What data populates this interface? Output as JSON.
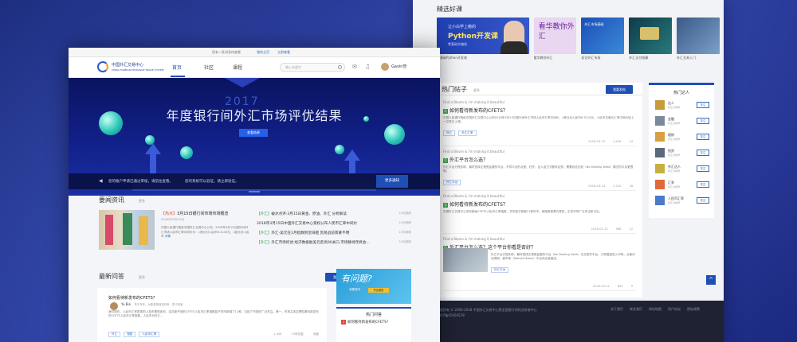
{
  "back": {
    "courses_title": "精选好课",
    "courses": [
      {
        "line1": "让小白学上瘾的",
        "line2": "Python开发课",
        "line3": "零基础学编程",
        "caption": "零基础Python开发课"
      },
      {
        "title": "看华教你外汇",
        "caption": "看华教你外汇"
      },
      {
        "title": "外汇市场基础",
        "caption": "初识外汇市场"
      },
      {
        "title": "",
        "caption": "外汇支付结算"
      },
      {
        "title": "",
        "caption": "外汇交易入门"
      }
    ],
    "hot_posts": {
      "title": "热门帖子",
      "more": "更多",
      "button": "我要发帖",
      "posts": [
        {
          "meta": "Find a Bloom & I'm making it beautiful",
          "title": "如何看待新发布的CFETS？",
          "body": "中国人民银行授权中国外汇交易中心公布2018年3月15日银行间外汇市场人民币汇率中间价，1美元对人民币6.3215元，人民币兑美元汇率中间价较上一交易日上调。",
          "tags": [
            "外汇",
            "外汇汇率"
          ],
          "date": "2018-03-15",
          "views": "1,456",
          "likes": "24"
        },
        {
          "meta": "Find a Bloom & I'm making it beautiful",
          "title": "外汇平台怎么选？",
          "body": "外汇平台分很多种，最好选择正规受监管的平台。不同平台的点差、杠杆、出入金方式都有区别，需要综合比较（No Dealing Desk）模式的平台更透明。",
          "tags": [
            "外汇平台"
          ],
          "date": "2018-03-14",
          "views": "1,210",
          "likes": "18"
        },
        {
          "meta": "Find a Bloom & I'm making it beautiful",
          "title": "如何看待新发布的CFETS？",
          "body": "中国外汇交易中心发布新版CFETS人民币汇率指数，货币篮子新增11种货币，使指数更具代表性，引发市场广泛关注和讨论。",
          "tags": [
            "外汇",
            "外汇汇率"
          ],
          "date": "2018-03-13",
          "views": "986",
          "likes": "12"
        },
        {
          "meta": "Find a Bloom & I'm making it beautiful",
          "title": "外汇平台怎么选？这个平台你看是否好？",
          "body": "外汇平台分很多种，最好选择正规受监管的平台（No Dealing Desk）无交易员平台，订单直接进入市场，点差浮动透明，做市商（Market Maker）平台则点差固定。",
          "tags": [
            "外汇平台"
          ],
          "date": "2018-03-12",
          "views": "854",
          "likes": "9"
        }
      ]
    },
    "tutors": {
      "title": "热门达人",
      "follow": "关注",
      "items": [
        {
          "name": "达人",
          "sub": "外汇分析师"
        },
        {
          "name": "金融",
          "sub": "外汇分析师"
        },
        {
          "name": "理财",
          "sub": "外汇分析师"
        },
        {
          "name": "投资",
          "sub": "外汇分析师"
        },
        {
          "name": "外汇达人",
          "sub": "外汇分析师"
        },
        {
          "name": "汇率",
          "sub": "外汇分析师"
        },
        {
          "name": "人民币汇率",
          "sub": "外汇分析师"
        }
      ]
    },
    "footer": {
      "copy": "版权所有 © 2000-2018 中国外汇交易中心暨全国银行间同业拆借中心",
      "icp": "沪ICP备05004578",
      "links": [
        "关于我们",
        "联系我们",
        "网站地图",
        "用户协议",
        "隐私政策"
      ]
    },
    "top_btn": "^"
  },
  "front": {
    "notice": {
      "text": "您有一条消息待查看",
      "link1": "我的主页",
      "link2": "立即查看"
    },
    "logo": {
      "cn": "中国外汇交易中心",
      "en": "CHINA FOREIGN EXCHANGE TRADE SYSTEM"
    },
    "nav": {
      "home": "首页",
      "community": "社区",
      "course": "课程"
    },
    "search_placeholder": "输入关键字",
    "user": "Gavin告",
    "banner": {
      "year": "2017",
      "title": "年度银行间外汇市场评优结果",
      "cta": "查看结果",
      "ticker1": "您的账户申请已通过审核，请前往查看。",
      "ticker2": "您的系统可以验证，请立即验证。",
      "more": "更多通知"
    },
    "news": {
      "title": "要闻资讯",
      "more": "更多",
      "main_tag": "【热点】",
      "main_title": "3月15日银行间市场市场概览",
      "main_date": "2018年03月15日",
      "main_desc": "中国人民银行授权中国外汇交易中心公布，2018年3月15日银行间外汇市场人民币汇率中间价为：1美元对人民币6.3145元，1欧元对人民币",
      "main_link": "详情",
      "list": [
        {
          "tag": "【外汇】",
          "title": "破冰点评:3月15日黄金、原油、外汇 分析解读",
          "date": "15分钟前"
        },
        {
          "tag": "",
          "title": "2018年3月15日中国外汇交易中心受权公布人民币汇率中间价",
          "date": "15分钟前"
        },
        {
          "tag": "【外汇】",
          "title": "外汇-美元在1月指数附近徘徊 贸易战前景蒙不明",
          "date": "15分钟前"
        },
        {
          "tag": "【外汇】",
          "title": "外汇市场综述:经济数据助美元走高90关口,市场静待年终会...",
          "date": "15分钟前"
        }
      ]
    },
    "qa": {
      "title": "最新问答",
      "more": "更多",
      "button": "我要提问",
      "question": "如何看待新发布的CFETS？",
      "answerer": "Yu Bin",
      "answerer_sub": "关于年年，对新事物保持好奇，勇于探索",
      "answer": "我们现在，人民币汇率表现的上发布着很多的，这次新开放的CFETS人民币汇率指数篮子货币新增了11种，引起了市场的广泛关注。第一，市场主体应理性看待新发布的CFETS人民币汇率指数。人民币对外汇...",
      "tags": [
        "外汇",
        "指数",
        "人民币汇率"
      ],
      "views": "1,456",
      "comments": "13条回复",
      "likes": "收藏",
      "ask_banner_big": "有问题?",
      "ask_banner_sm": "我要提问",
      "ask_banner_pill": "专业解答",
      "hot_title": "热门问答",
      "hot_item": "如何看待新发布的CFETS？",
      "hot_num": "1"
    }
  }
}
